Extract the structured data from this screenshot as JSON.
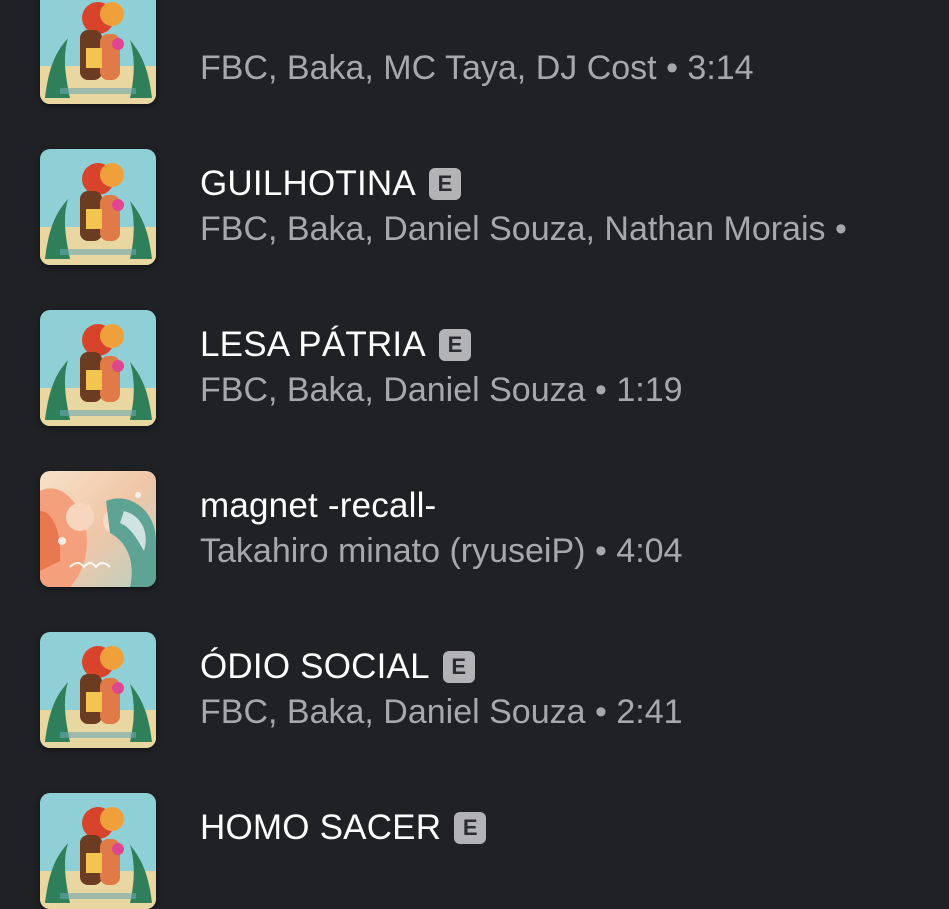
{
  "tracks": [
    {
      "title": "",
      "explicit": false,
      "artists": "FBC, Baka, MC Taya, DJ Cost",
      "separator": "•",
      "duration": "3:14",
      "cover": "album-art-fbc"
    },
    {
      "title": "GUILHOTINA",
      "explicit": true,
      "explicit_label": "E",
      "artists": "FBC, Baka, Daniel Souza, Nathan Morais",
      "separator": "•",
      "duration": "",
      "cover": "album-art-fbc"
    },
    {
      "title": "LESA PÁTRIA",
      "explicit": true,
      "explicit_label": "E",
      "artists": "FBC, Baka, Daniel Souza",
      "separator": "•",
      "duration": "1:19",
      "cover": "album-art-fbc"
    },
    {
      "title": "magnet -recall-",
      "explicit": false,
      "artists": "Takahiro minato (ryuseiP)",
      "separator": "•",
      "duration": "4:04",
      "cover": "album-art-magnet"
    },
    {
      "title": "ÓDIO SOCIAL",
      "explicit": true,
      "explicit_label": "E",
      "artists": "FBC, Baka, Daniel Souza",
      "separator": "•",
      "duration": "2:41",
      "cover": "album-art-fbc"
    },
    {
      "title": "HOMO SACER",
      "explicit": true,
      "explicit_label": "E",
      "artists": "",
      "separator": "",
      "duration": "",
      "cover": "album-art-fbc"
    }
  ],
  "colors": {
    "background": "#1f2125",
    "title": "#ffffff",
    "meta": "#a7a8ad",
    "explicit_badge": "#b3b3b6"
  }
}
